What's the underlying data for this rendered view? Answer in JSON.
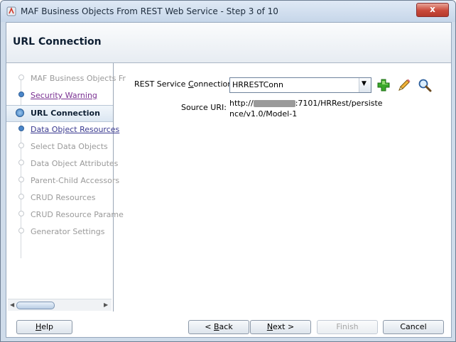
{
  "window": {
    "title": "MAF Business Objects From REST Web Service - Step 3 of 10",
    "close_label": "x"
  },
  "header": {
    "title": "URL Connection"
  },
  "steps": [
    {
      "label": "MAF Business Objects Fr",
      "state": "done"
    },
    {
      "label": "Security Warning",
      "state": "visited"
    },
    {
      "label": "URL Connection",
      "state": "current"
    },
    {
      "label": "Data Object Resources",
      "state": "link"
    },
    {
      "label": "Select Data Objects",
      "state": "disabled"
    },
    {
      "label": "Data Object Attributes",
      "state": "disabled"
    },
    {
      "label": "Parent-Child Accessors",
      "state": "disabled"
    },
    {
      "label": "CRUD Resources",
      "state": "disabled"
    },
    {
      "label": "CRUD Resource Parame",
      "state": "disabled"
    },
    {
      "label": "Generator Settings",
      "state": "disabled"
    }
  ],
  "form": {
    "connection_label_pre": "REST Service ",
    "connection_label_mnemonic": "C",
    "connection_label_post": "onnection:",
    "connection_value": "HRRESTConn",
    "source_uri_label": "Source URI:",
    "source_uri_line1_prefix": "http://",
    "source_uri_line1_suffix": ":7101/HRRest/persiste",
    "source_uri_line2": "nce/v1.0/Model-1"
  },
  "buttons": {
    "help_mnemonic": "H",
    "help_rest": "elp",
    "back_pre": "< ",
    "back_mnemonic": "B",
    "back_rest": "ack",
    "next_mnemonic": "N",
    "next_rest": "ext >",
    "finish_label": "Finish",
    "cancel_label": "Cancel"
  },
  "icons": {
    "add": "plus-icon",
    "edit": "pencil-icon",
    "browse": "magnifier-icon"
  },
  "colors": {
    "accent_blue": "#3e7fc0",
    "link": "#3a3a90",
    "visited": "#7a3092",
    "add_green": "#3aa82a"
  }
}
